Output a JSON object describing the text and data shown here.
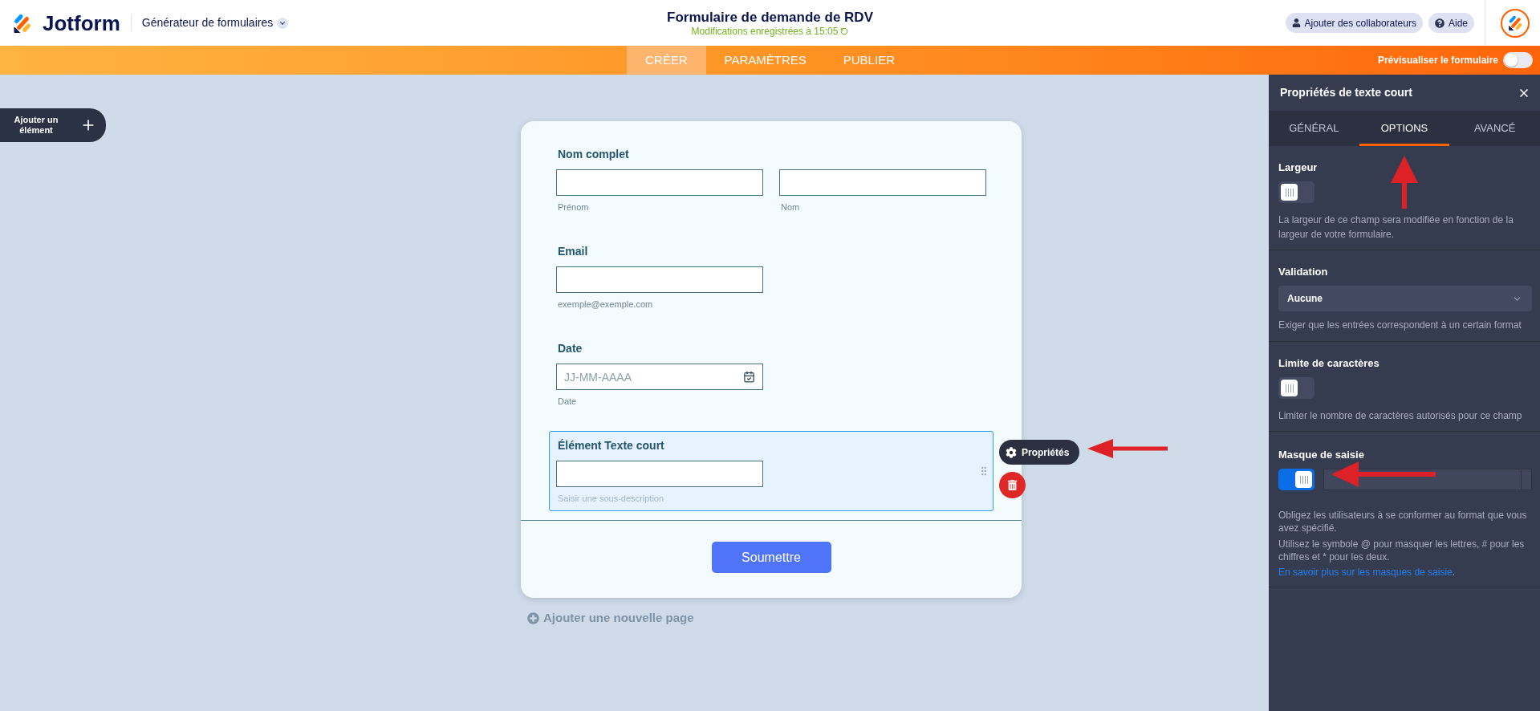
{
  "header": {
    "logo_text": "Jotform",
    "builder_menu": "Générateur de formulaires",
    "title": "Formulaire de demande de RDV",
    "save_status": "Modifications enregistrées à 15:05",
    "buttons": [
      {
        "kind": "collaborators",
        "label": "Ajouter des collaborateurs"
      },
      {
        "kind": "help",
        "label": "Aide"
      }
    ]
  },
  "nav": {
    "tabs": [
      {
        "label": "CRÉER",
        "selected": true
      },
      {
        "label": "PARAMÈTRES",
        "selected": false
      },
      {
        "label": "PUBLIER",
        "selected": false
      }
    ],
    "preview": {
      "label": "Prévisualiser le formulaire",
      "on": false
    }
  },
  "add_element_button": "Ajouter un élément",
  "form": {
    "fields": [
      {
        "kind": "fullname",
        "label": "Nom complet",
        "sublabels": [
          "Prénom",
          "Nom"
        ],
        "selected": false
      },
      {
        "kind": "email",
        "label": "Email",
        "sublabel": "exemple@exemple.com",
        "selected": false
      },
      {
        "kind": "date",
        "label": "Date",
        "placeholder": "JJ-MM-AAAA",
        "sublabel": "Date",
        "selected": false
      },
      {
        "kind": "text",
        "label": "Élément Texte court",
        "sublabel_placeholder": "Saisir une sous-description",
        "selected": true
      }
    ],
    "properties_button": "Propriétés",
    "submit_button": "Soumettre"
  },
  "add_page": "Ajouter une nouvelle page",
  "panel": {
    "title": "Propriétés de texte court",
    "tabs": [
      {
        "label": "GÉNÉRAL",
        "selected": false
      },
      {
        "label": "OPTIONS",
        "selected": true
      },
      {
        "label": "AVANCÉ",
        "selected": false
      }
    ],
    "sections": [
      {
        "kind": "toggle",
        "label": "Largeur",
        "on": false,
        "description": "La largeur de ce champ sera modifiée en fonction de la largeur de votre formulaire."
      },
      {
        "kind": "select",
        "label": "Validation",
        "value": "Aucune",
        "description": "Exiger que les entrées correspondent à un certain format"
      },
      {
        "kind": "toggle",
        "label": "Limite de caractères",
        "on": false,
        "description": "Limiter le nombre de caractères autorisés pour ce champ"
      },
      {
        "kind": "mask",
        "label": "Masque de saisie",
        "on": true,
        "description": "Obligez les utilisateurs à se conformer au format que vous avez spécifié.",
        "note": "Utilisez le symbole @ pour masquer les lettres, # pour les chiffres et * pour les deux.",
        "link": "En savoir plus sur les masques de saisie",
        "link_suffix": "."
      }
    ]
  }
}
